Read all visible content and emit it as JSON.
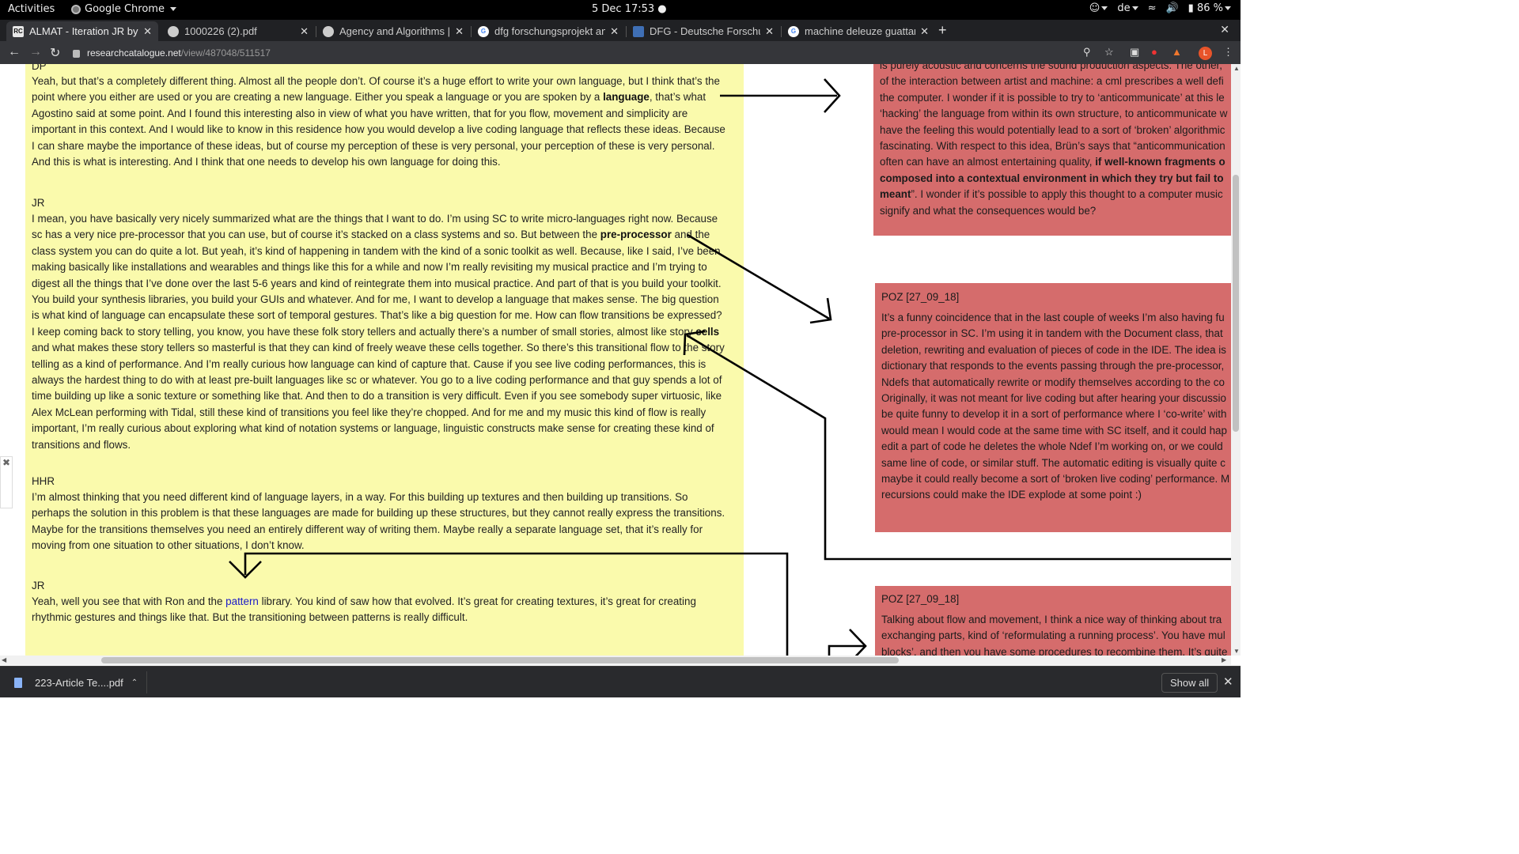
{
  "topbar": {
    "activities": "Activities",
    "app_name": "Google Chrome",
    "clock": "5 Dec  17:53 ●",
    "lang": "de",
    "battery": "86 %"
  },
  "tabs": [
    {
      "label": "ALMAT - Iteration JR by H",
      "favicon": "RC"
    },
    {
      "label": "1000226 (2).pdf",
      "favicon": ""
    },
    {
      "label": "Agency and Algorithms | J",
      "favicon": ""
    },
    {
      "label": "dfg forschungsprojekt ant",
      "favicon": "G"
    },
    {
      "label": "DFG - Deutsche Forschun",
      "favicon": ""
    },
    {
      "label": "machine deleuze guattari",
      "favicon": "G"
    }
  ],
  "url": {
    "host": "researchcatalogue.net",
    "path": "/view/487048/511517"
  },
  "conversation": {
    "dp_label": "DP",
    "dp_lines": [
      [
        "Yeah, but that’s a completely different thing. Almost all the people don’t. Of course it’s a huge effort to write your own language, but I think that’s the"
      ],
      [
        "point where you either are used or you are creating a new language. Either you speak a language or you are spoken by a ",
        "language",
        ", that’s what"
      ],
      [
        "Agostino said at some point. And I found this interesting also in view of what you have written, that for you flow, movement and simplicity are"
      ],
      [
        "important in this context. And I would like to know in this residence how you would develop a live coding language that reflects these ideas. Because"
      ],
      [
        "I can share maybe the importance of these ideas, but of course my perception of these is very personal, your perception of these is very personal."
      ],
      [
        "And this is what is interesting. And I think that one needs to develop his own language for doing this."
      ]
    ],
    "jr1_label": "JR",
    "jr1_lines": [
      [
        "I mean, you have basically very nicely summarized what are the things that I want to do. I’m using SC to write micro-languages right now. Because"
      ],
      [
        "sc has a very nice pre-processor that you can use, but of course it’s stacked on a class systems and so. But between the ",
        "pre-processor",
        " and the"
      ],
      [
        "class system you can do quite a lot. But yeah, it’s kind of happening in tandem with the kind of a sonic toolkit as well. Because, like I said, I’ve been"
      ],
      [
        "making basically like installations and wearables and things like this for a while and now I’m really revisiting my musical practice and I’m trying to"
      ],
      [
        "digest all the things that I’ve done over the last 5-6 years and kind of reintegrate them into musical practice. And part of that is you build your toolkit."
      ],
      [
        "You build your synthesis libraries, you build your GUIs and whatever. And for me, I want to develop a language that makes sense. The big question"
      ],
      [
        "is what kind of language can encapsulate these sort of temporal gestures. That’s like a big question for me. How can flow transitions be expressed?"
      ],
      [
        "I keep coming back to story telling, you know, you have these folk story tellers and actually there’s a number of small stories, almost like story ",
        "cells"
      ],
      [
        "and what makes these story tellers so masterful is that they can kind of freely weave these cells together. So there’s this transitional flow to the story"
      ],
      [
        "telling as a kind of performance. And I’m really curious how language can kind of capture that. Cause if you see live coding performances, this is"
      ],
      [
        "always the hardest thing to do with at least pre-built languages like sc or whatever. You go to a live coding performance and that guy spends a lot of"
      ],
      [
        "time building up like a sonic texture or something like that. And then to do a transition is very difficult. Even if you see somebody super virtuosic, like"
      ],
      [
        "Alex McLean performing with Tidal, still these kind of transitions you feel like they’re chopped. And for me and my music this kind of flow is really"
      ],
      [
        "important, I’m really curious about exploring what kind of notation systems or language, linguistic constructs make sense for creating these kind of"
      ],
      [
        "transitions and flows."
      ]
    ],
    "hhr_label": "HHR",
    "hhr_lines": [
      [
        "I’m almost thinking that you need different kind of language layers, in a way. For this building up textures and then building up transitions. So"
      ],
      [
        "perhaps the solution in this problem is that these languages are made for building up these structures, but they cannot really express the transitions."
      ],
      [
        "Maybe for the transitions themselves you need an entirely different way of writing them. Maybe really a separate language set, that it’s really for"
      ],
      [
        "moving from one situation to other situations, I don’t know."
      ]
    ],
    "jr2_label": "JR",
    "jr2_lines": [
      [
        "Yeah, well you see that with Ron and the ",
        "pattern",
        " library. You kind of saw how that evolved. It’s great for creating textures, it’s great for creating"
      ],
      [
        "rhythmic gestures and things like that. But the transitioning between patterns is really difficult."
      ]
    ]
  },
  "notes": {
    "top_lines": [
      [
        "is purely acoustic and concerns the sound production aspects. The other,"
      ],
      [
        "of the interaction between artist and machine: a cml prescribes a well defi"
      ],
      [
        "the computer. I wonder if it is possible to try to ‘anticommunicate’ at this le"
      ],
      [
        "‘hacking’ the language from within its own structure, to anticommunicate w"
      ],
      [
        "have the feeling this would potentially lead to a sort of ‘broken’ algorithmic"
      ],
      [
        "fascinating. With respect to this idea, Brün’s says that “anticommunication"
      ],
      [
        "often can have an almost entertaining quality, ",
        "if well-known fragments o"
      ],
      [
        "",
        "composed into a contextual environment in which they try but fail to"
      ],
      [
        "",
        "meant",
        "”. I wonder if it’s possible to apply this thought to a computer music"
      ],
      [
        "signify and what the consequences would be?"
      ]
    ],
    "poz1_title": "POZ [27_09_18]",
    "poz1_lines": [
      [
        "It’s a funny coincidence that in the last couple of weeks I’m also having fu"
      ],
      [
        "pre-processor in SC. I’m using it in tandem with the Document class, that"
      ],
      [
        "deletion, rewriting and evaluation of pieces of code in the IDE. The idea is"
      ],
      [
        "dictionary that responds to the events passing through the pre-processor,"
      ],
      [
        "Ndefs that automatically rewrite or modify themselves according to the co"
      ],
      [
        "Originally, it was not meant for live coding but after hearing your discussio"
      ],
      [
        "be quite funny to develop it in a sort of performance where I ‘co-write’ with"
      ],
      [
        "would mean I would code at the same time with SC itself, and it could hap"
      ],
      [
        "edit a part of code he deletes the whole Ndef I’m working on, or we could"
      ],
      [
        "same line of code, or similar stuff. The automatic editing is visually quite c"
      ],
      [
        "maybe it could really become a sort of ‘broken live coding’ performance. M"
      ],
      [
        "recursions could make the IDE explode at some point :)"
      ]
    ],
    "poz2_title": "POZ [27_09_18]",
    "poz2_lines": [
      [
        "Talking about flow and movement, I think a nice way of thinking about tra"
      ],
      [
        "exchanging parts, kind of ‘reformulating a running process’. You have mul"
      ],
      [
        "blocks’, and then you have some procedures to recombine them. It’s quite"
      ]
    ]
  },
  "downloads": {
    "file": "223-Article Te....pdf",
    "show_all": "Show all"
  },
  "colors": {
    "note_red": "#d56c6c",
    "highlight_yellow": "#fafaac",
    "link_blue": "#1a1ac8"
  }
}
